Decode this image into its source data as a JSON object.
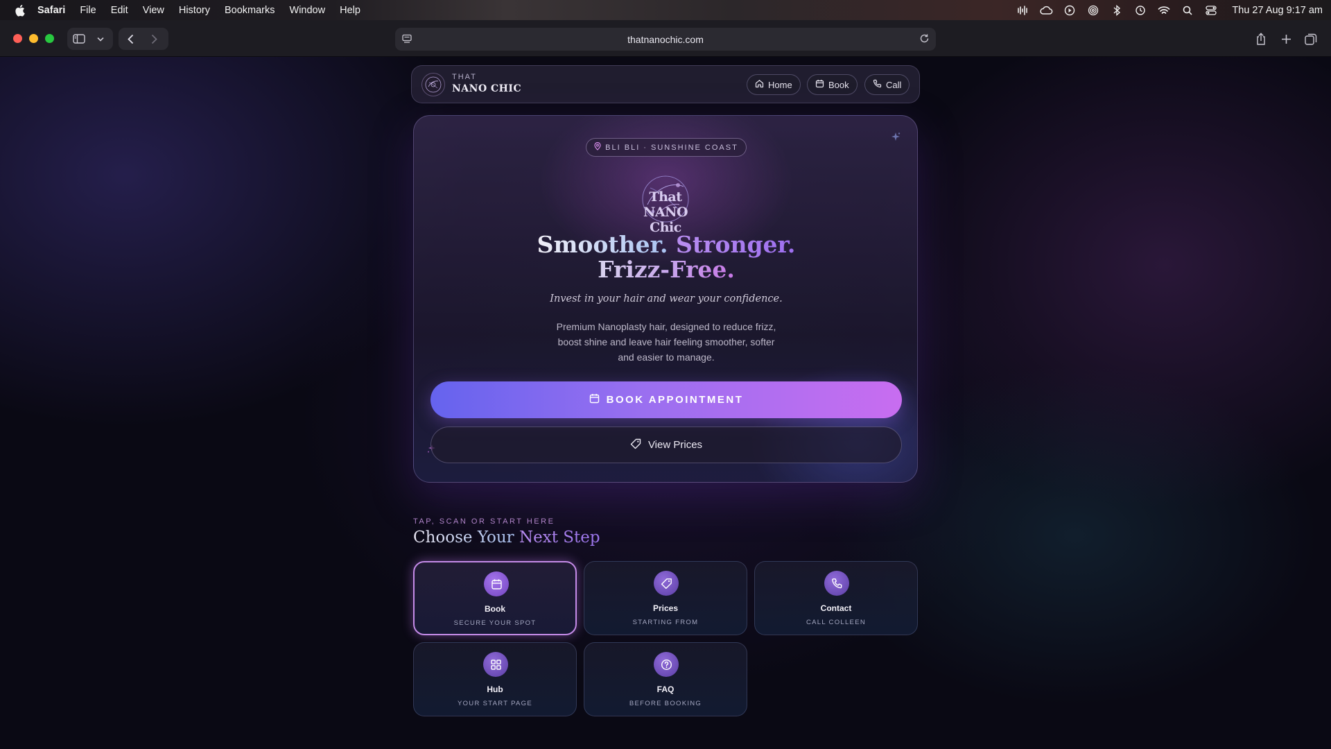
{
  "menubar": {
    "app": "Safari",
    "items": [
      "File",
      "Edit",
      "View",
      "History",
      "Bookmarks",
      "Window",
      "Help"
    ],
    "clock": "Thu 27 Aug  9:17 am",
    "status_icons": [
      "audio-waveform-icon",
      "cloud-icon",
      "play-icon",
      "airdrop-icon",
      "bluetooth-icon",
      "time-machine-icon",
      "wifi-icon",
      "search-icon",
      "control-center-icon"
    ]
  },
  "browser": {
    "url": "thatnanochic.com"
  },
  "site_nav": {
    "brand_top": "THAT",
    "brand_main": "NANO CHIC",
    "links": [
      {
        "label": "Home",
        "icon": "home-icon"
      },
      {
        "label": "Book",
        "icon": "calendar-icon"
      },
      {
        "label": "Call",
        "icon": "phone-icon"
      }
    ]
  },
  "hero": {
    "location": "BLI BLI · SUNSHINE COAST",
    "logo_text": "That NANO Chic",
    "headline_1a": "Smoother.",
    "headline_1b": "Stronger.",
    "headline_2": "Frizz-Free.",
    "tagline": "Invest in your hair and wear your confidence.",
    "description": "Premium Nanoplasty hair, designed to reduce frizz, boost shine and leave hair feeling smoother, softer and easier to manage.",
    "primary_button": "BOOK APPOINTMENT",
    "secondary_button": "View Prices"
  },
  "next_step": {
    "kicker": "TAP, SCAN OR START HERE",
    "title_a": "Choose Your",
    "title_b": "Next Step",
    "cards": [
      {
        "title": "Book",
        "subtitle": "SECURE YOUR SPOT",
        "icon": "calendar-icon"
      },
      {
        "title": "Prices",
        "subtitle": "STARTING FROM",
        "icon": "tag-icon"
      },
      {
        "title": "Contact",
        "subtitle": "CALL COLLEEN",
        "icon": "phone-icon"
      },
      {
        "title": "Hub",
        "subtitle": "YOUR START PAGE",
        "icon": "grid-icon"
      },
      {
        "title": "FAQ",
        "subtitle": "BEFORE BOOKING",
        "icon": "help-circle-icon"
      }
    ]
  },
  "colors": {
    "accent_start": "#6563ee",
    "accent_end": "#c86df0",
    "background": "#0a0914"
  }
}
